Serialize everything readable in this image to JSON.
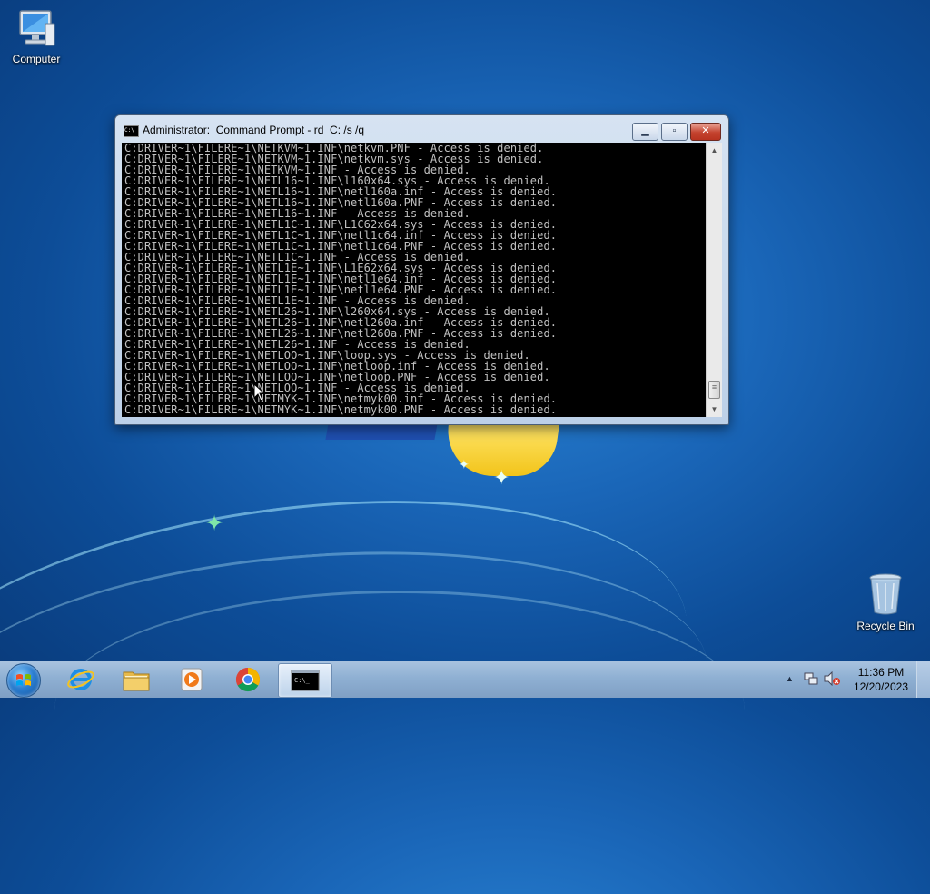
{
  "desktop": {
    "icons": [
      {
        "label": "Computer",
        "icon": "computer-icon"
      },
      {
        "label": "Recycle Bin",
        "icon": "recycle-bin-icon"
      }
    ]
  },
  "window": {
    "title": "Administrator:  Command Prompt - rd  C: /s /q",
    "icon": "cmd-icon",
    "controls": {
      "minimize": "minimize-icon",
      "maximize": "maximize-icon",
      "close": "close-icon"
    },
    "console_lines": [
      "C:DRIVER~1\\FILERE~1\\NETKVM~1.INF\\netkvm.PNF - Access is denied.",
      "C:DRIVER~1\\FILERE~1\\NETKVM~1.INF\\netkvm.sys - Access is denied.",
      "C:DRIVER~1\\FILERE~1\\NETKVM~1.INF - Access is denied.",
      "C:DRIVER~1\\FILERE~1\\NETL16~1.INF\\l160x64.sys - Access is denied.",
      "C:DRIVER~1\\FILERE~1\\NETL16~1.INF\\netl160a.inf - Access is denied.",
      "C:DRIVER~1\\FILERE~1\\NETL16~1.INF\\netl160a.PNF - Access is denied.",
      "C:DRIVER~1\\FILERE~1\\NETL16~1.INF - Access is denied.",
      "C:DRIVER~1\\FILERE~1\\NETL1C~1.INF\\L1C62x64.sys - Access is denied.",
      "C:DRIVER~1\\FILERE~1\\NETL1C~1.INF\\netl1c64.inf - Access is denied.",
      "C:DRIVER~1\\FILERE~1\\NETL1C~1.INF\\netl1c64.PNF - Access is denied.",
      "C:DRIVER~1\\FILERE~1\\NETL1C~1.INF - Access is denied.",
      "C:DRIVER~1\\FILERE~1\\NETL1E~1.INF\\L1E62x64.sys - Access is denied.",
      "C:DRIVER~1\\FILERE~1\\NETL1E~1.INF\\netl1e64.inf - Access is denied.",
      "C:DRIVER~1\\FILERE~1\\NETL1E~1.INF\\netl1e64.PNF - Access is denied.",
      "C:DRIVER~1\\FILERE~1\\NETL1E~1.INF - Access is denied.",
      "C:DRIVER~1\\FILERE~1\\NETL26~1.INF\\l260x64.sys - Access is denied.",
      "C:DRIVER~1\\FILERE~1\\NETL26~1.INF\\netl260a.inf - Access is denied.",
      "C:DRIVER~1\\FILERE~1\\NETL26~1.INF\\netl260a.PNF - Access is denied.",
      "C:DRIVER~1\\FILERE~1\\NETL26~1.INF - Access is denied.",
      "C:DRIVER~1\\FILERE~1\\NETLOO~1.INF\\loop.sys - Access is denied.",
      "C:DRIVER~1\\FILERE~1\\NETLOO~1.INF\\netloop.inf - Access is denied.",
      "C:DRIVER~1\\FILERE~1\\NETLOO~1.INF\\netloop.PNF - Access is denied.",
      "C:DRIVER~1\\FILERE~1\\NETLOO~1.INF - Access is denied.",
      "C:DRIVER~1\\FILERE~1\\NETMYK~1.INF\\netmyk00.inf - Access is denied.",
      "C:DRIVER~1\\FILERE~1\\NETMYK~1.INF\\netmyk00.PNF - Access is denied."
    ]
  },
  "taskbar": {
    "start": "windows-start-icon",
    "pinned": [
      {
        "name": "internet-explorer",
        "icon": "internet-explorer-icon"
      },
      {
        "name": "file-explorer",
        "icon": "folder-icon"
      },
      {
        "name": "media-player",
        "icon": "media-player-icon"
      },
      {
        "name": "chrome",
        "icon": "chrome-icon"
      },
      {
        "name": "command-prompt",
        "icon": "cmd-icon",
        "active": true
      }
    ],
    "tray": {
      "icons": [
        "show-hidden-icons-arrow",
        "network-icon",
        "volume-muted-icon"
      ],
      "time": "11:36 PM",
      "date": "12/20/2023"
    }
  },
  "colors": {
    "console_bg": "#000000",
    "console_text": "#c0c0c0",
    "close_button": "#c4432f",
    "wallpaper": "#1a66b8"
  }
}
